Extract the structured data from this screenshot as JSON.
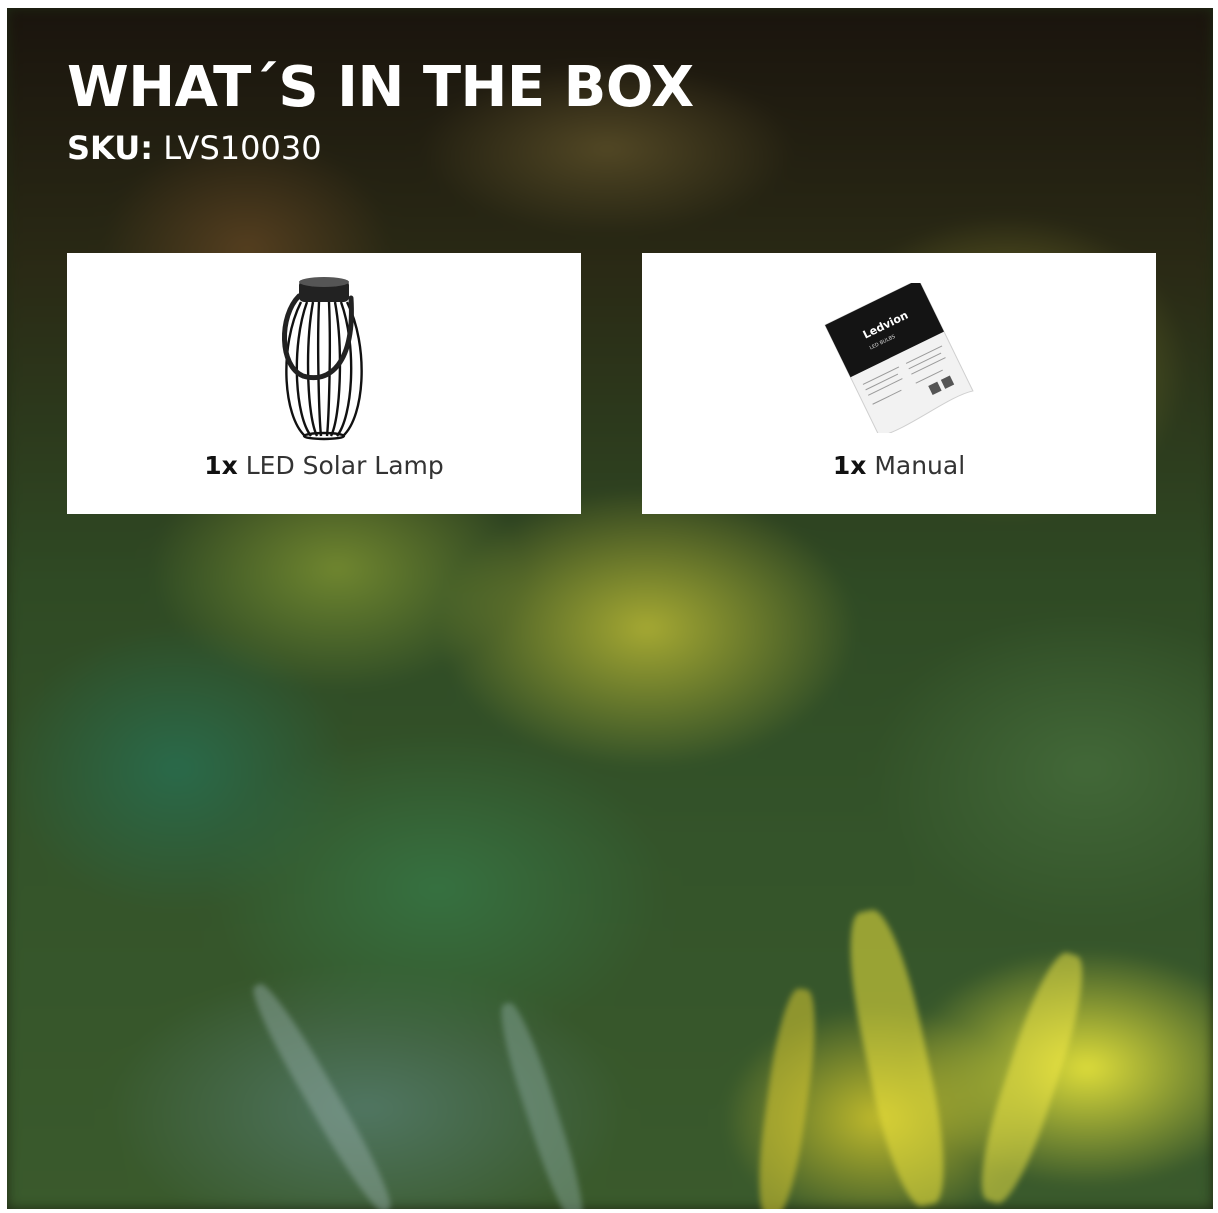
{
  "header": {
    "title": "WHAT´S IN THE BOX",
    "sku_label": "SKU:",
    "sku_value": "LVS10030"
  },
  "items": [
    {
      "qty": "1x",
      "name": "LED Solar Lamp",
      "icon": "lantern-image"
    },
    {
      "qty": "1x",
      "name": "Manual",
      "icon": "manual-image"
    }
  ],
  "manual_brand": "Ledvion",
  "manual_heading": "LED BULBS"
}
